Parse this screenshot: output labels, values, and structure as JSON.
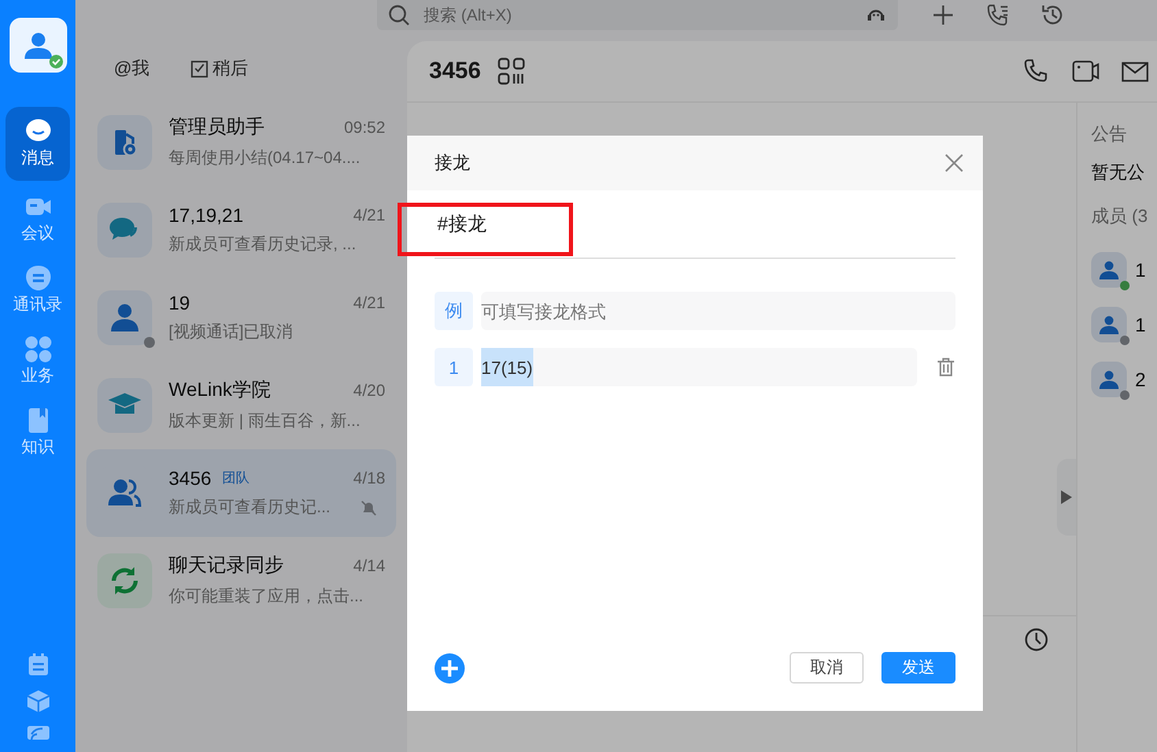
{
  "nav_items": [
    {
      "label": "消息",
      "kind": "message",
      "selected": true
    },
    {
      "label": "会议",
      "kind": "meeting",
      "selected": false
    },
    {
      "label": "通讯录",
      "kind": "contacts",
      "selected": false
    },
    {
      "label": "业务",
      "kind": "apps",
      "selected": false
    },
    {
      "label": "知识",
      "kind": "knowledge",
      "selected": false
    }
  ],
  "search": {
    "placeholder": "搜索 (Alt+X)"
  },
  "filters": [
    {
      "label": "@我"
    },
    {
      "label": "稍后"
    }
  ],
  "conversations": [
    {
      "kind": "admin",
      "name": "管理员助手",
      "time": "09:52",
      "preview": "每周使用小结(04.17~04....",
      "selected": false,
      "muted": false
    },
    {
      "kind": "chat",
      "name": "17,19,21",
      "time": "4/21",
      "preview": "新成员可查看历史记录, ...",
      "selected": false,
      "muted": false
    },
    {
      "kind": "person",
      "name": "19",
      "time": "4/21",
      "preview": "[视频通话]已取消",
      "selected": false,
      "muted": false,
      "offline": true
    },
    {
      "kind": "school",
      "name": "WeLink学院",
      "time": "4/20",
      "preview": "版本更新 | 雨生百谷，新...",
      "selected": false,
      "muted": false
    },
    {
      "kind": "team",
      "name": "3456",
      "tag": "团队",
      "time": "4/18",
      "preview": "新成员可查看历史记...",
      "selected": true,
      "muted": true
    },
    {
      "kind": "sync",
      "name": "聊天记录同步",
      "time": "4/14",
      "preview": "你可能重装了应用，点击...",
      "selected": false,
      "muted": false
    }
  ],
  "chat": {
    "title": "3456"
  },
  "side_panel": {
    "announcement_heading": "公告",
    "announcement": "暂无公",
    "members_heading": "成员 (3",
    "members": [
      {
        "name": "1",
        "online": true
      },
      {
        "name": "1",
        "online": false
      },
      {
        "name": "2",
        "online": false
      }
    ]
  },
  "dialog": {
    "title": "接龙",
    "topic": "#接龙",
    "example_label": "例",
    "example_placeholder": "可填写接龙格式",
    "entries": [
      {
        "index": "1",
        "value": "17(15)",
        "selected": true
      }
    ],
    "buttons": [
      {
        "label": "取消",
        "kind": "secondary"
      },
      {
        "label": "发送",
        "kind": "primary"
      }
    ]
  }
}
